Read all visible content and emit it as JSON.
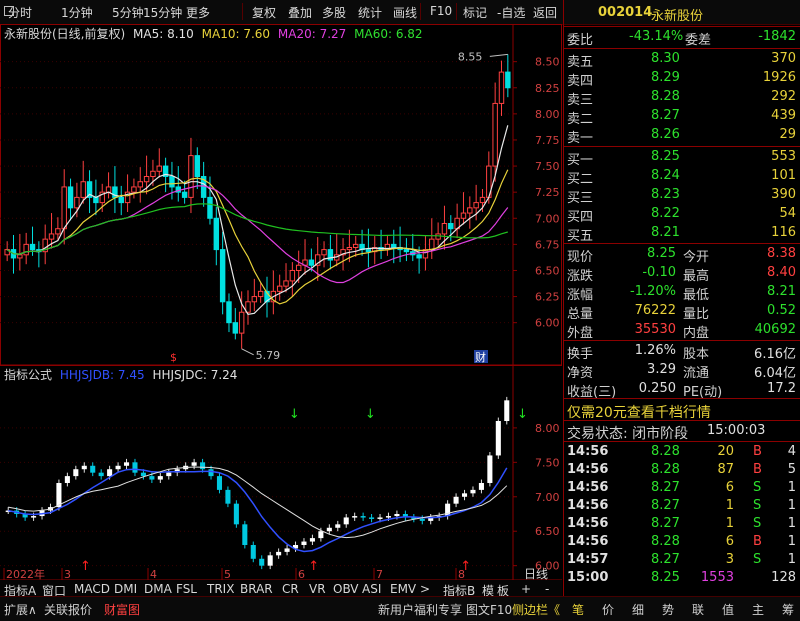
{
  "toolbar": {
    "items": [
      "分时",
      "1分钟",
      "5分钟",
      "15分钟",
      "更多",
      "复权",
      "叠加",
      "多股",
      "统计",
      "画线",
      "F10",
      "标记",
      "-自选",
      "返回"
    ]
  },
  "main_chart": {
    "title": "永新股份(日线,前复权)",
    "ma5": "MA5: 8.10",
    "ma10": "MA10: 7.60",
    "ma20": "MA20: 7.27",
    "ma60": "MA60: 6.82",
    "y_ticks": [
      "8.50",
      "8.25",
      "8.00",
      "7.75",
      "7.50",
      "7.25",
      "7.00",
      "6.75",
      "6.50",
      "6.25",
      "6.00"
    ],
    "high_label": "8.55",
    "low_label": "5.79",
    "marker_s": "$",
    "marker_cai": "财"
  },
  "sub_chart": {
    "title": "指标公式",
    "l1": "HHJSJDB: 7.45",
    "l2": "HHJSJDC: 7.24",
    "y_ticks": [
      "8.00",
      "7.50",
      "7.00",
      "6.50",
      "6.00"
    ]
  },
  "x_axis": {
    "labels": [
      "2022年",
      "3",
      "4",
      "5",
      "6",
      "7",
      "8"
    ],
    "period": "日线"
  },
  "indicator_tabs": [
    "指标A",
    "窗口",
    "MACD",
    "DMI",
    "DMA",
    "FSL",
    "TRIX",
    "BRAR",
    "CR",
    "VR",
    "OBV",
    "ASI",
    "EMV",
    ">",
    "指标B",
    "模",
    "板",
    "+",
    "-"
  ],
  "bottom_bar": {
    "left": [
      "扩展∧",
      "关联报价",
      "财富图"
    ],
    "mid": [
      "新用户福利专享",
      "图文F10",
      "侧边栏《"
    ],
    "right": [
      "笔",
      "价",
      "细",
      "势",
      "联",
      "值",
      "主",
      "筹"
    ]
  },
  "quote": {
    "code": "002014",
    "name": "永新股份",
    "weibi_label": "委比",
    "weibi": "-43.14%",
    "weicha_label": "委差",
    "weicha": "-1842",
    "asks": [
      {
        "label": "卖五",
        "price": "8.30",
        "vol": "370"
      },
      {
        "label": "卖四",
        "price": "8.29",
        "vol": "1926"
      },
      {
        "label": "卖三",
        "price": "8.28",
        "vol": "292"
      },
      {
        "label": "卖二",
        "price": "8.27",
        "vol": "439"
      },
      {
        "label": "卖一",
        "price": "8.26",
        "vol": "29"
      }
    ],
    "bids": [
      {
        "label": "买一",
        "price": "8.25",
        "vol": "553"
      },
      {
        "label": "买二",
        "price": "8.24",
        "vol": "101"
      },
      {
        "label": "买三",
        "price": "8.23",
        "vol": "390"
      },
      {
        "label": "买四",
        "price": "8.22",
        "vol": "54"
      },
      {
        "label": "买五",
        "price": "8.21",
        "vol": "116"
      }
    ],
    "stats": [
      {
        "l1": "现价",
        "v1": "8.25",
        "c1": "g",
        "l2": "今开",
        "v2": "8.38",
        "c2": "r"
      },
      {
        "l1": "涨跌",
        "v1": "-0.10",
        "c1": "g",
        "l2": "最高",
        "v2": "8.40",
        "c2": "r"
      },
      {
        "l1": "涨幅",
        "v1": "-1.20%",
        "c1": "g",
        "l2": "最低",
        "v2": "8.21",
        "c2": "g"
      },
      {
        "l1": "总量",
        "v1": "76222",
        "c1": "y",
        "l2": "量比",
        "v2": "0.52",
        "c2": "g"
      },
      {
        "l1": "外盘",
        "v1": "35530",
        "c1": "r",
        "l2": "内盘",
        "v2": "40692",
        "c2": "g"
      }
    ],
    "stats2": [
      {
        "l1": "换手",
        "v1": "1.26%",
        "l2": "股本",
        "v2": "6.16亿"
      },
      {
        "l1": "净资",
        "v1": "3.29",
        "l2": "流通",
        "v2": "6.04亿"
      },
      {
        "l1": "收益(三)",
        "v1": "0.250",
        "l2": "PE(动)",
        "v2": "17.2"
      }
    ],
    "promo": "仅需20元查看千档行情",
    "status_label": "交易状态: 闭市阶段",
    "status_time": "15:00:03",
    "trades": [
      {
        "t": "14:56",
        "p": "8.28",
        "v": "20",
        "bs": "B",
        "n": "4"
      },
      {
        "t": "14:56",
        "p": "8.28",
        "v": "87",
        "bs": "B",
        "n": "5"
      },
      {
        "t": "14:56",
        "p": "8.27",
        "v": "6",
        "bs": "S",
        "n": "1"
      },
      {
        "t": "14:56",
        "p": "8.27",
        "v": "1",
        "bs": "S",
        "n": "1"
      },
      {
        "t": "14:56",
        "p": "8.27",
        "v": "1",
        "bs": "S",
        "n": "1"
      },
      {
        "t": "14:56",
        "p": "8.28",
        "v": "6",
        "bs": "B",
        "n": "1"
      },
      {
        "t": "14:57",
        "p": "8.27",
        "v": "3",
        "bs": "S",
        "n": "1"
      },
      {
        "t": "15:00",
        "p": "8.25",
        "v": "1553",
        "bs": "",
        "n": "128"
      }
    ]
  },
  "chart_data": {
    "type": "candlestick",
    "y_range": [
      5.7,
      8.65
    ],
    "closes": [
      6.7,
      6.62,
      6.65,
      6.75,
      6.7,
      6.68,
      6.8,
      6.85,
      6.9,
      7.3,
      7.1,
      7.2,
      7.35,
      7.2,
      7.15,
      7.25,
      7.3,
      7.2,
      7.15,
      7.25,
      7.3,
      7.35,
      7.4,
      7.45,
      7.5,
      7.4,
      7.3,
      7.25,
      7.2,
      7.6,
      7.4,
      7.2,
      7.0,
      6.7,
      6.2,
      6.0,
      5.9,
      6.1,
      6.2,
      6.25,
      6.3,
      6.2,
      6.3,
      6.35,
      6.4,
      6.5,
      6.55,
      6.6,
      6.55,
      6.65,
      6.7,
      6.6,
      6.65,
      6.7,
      6.72,
      6.75,
      6.7,
      6.68,
      6.72,
      6.7,
      6.75,
      6.72,
      6.7,
      6.68,
      6.65,
      6.62,
      6.7,
      6.8,
      6.85,
      6.95,
      6.9,
      7.0,
      7.05,
      7.1,
      7.15,
      7.2,
      7.5,
      8.1,
      8.4,
      8.25
    ],
    "sub_values": [
      6.8,
      6.75,
      6.7,
      6.72,
      6.8,
      6.85,
      7.2,
      7.3,
      7.4,
      7.45,
      7.35,
      7.3,
      7.4,
      7.45,
      7.5,
      7.35,
      7.3,
      7.25,
      7.3,
      7.35,
      7.4,
      7.45,
      7.5,
      7.4,
      7.3,
      7.1,
      6.9,
      6.6,
      6.3,
      6.1,
      6.0,
      6.15,
      6.2,
      6.25,
      6.3,
      6.35,
      6.4,
      6.5,
      6.55,
      6.6,
      6.7,
      6.72,
      6.7,
      6.68,
      6.7,
      6.72,
      6.75,
      6.7,
      6.68,
      6.65,
      6.7,
      6.72,
      6.9,
      7.0,
      7.05,
      7.1,
      7.2,
      7.6,
      8.1,
      8.4
    ],
    "sub_range": [
      5.85,
      8.55
    ],
    "buy_markers": [
      3,
      12,
      18,
      29,
      44,
      52
    ],
    "sell_markers": [
      11,
      14,
      20,
      46,
      48
    ]
  }
}
